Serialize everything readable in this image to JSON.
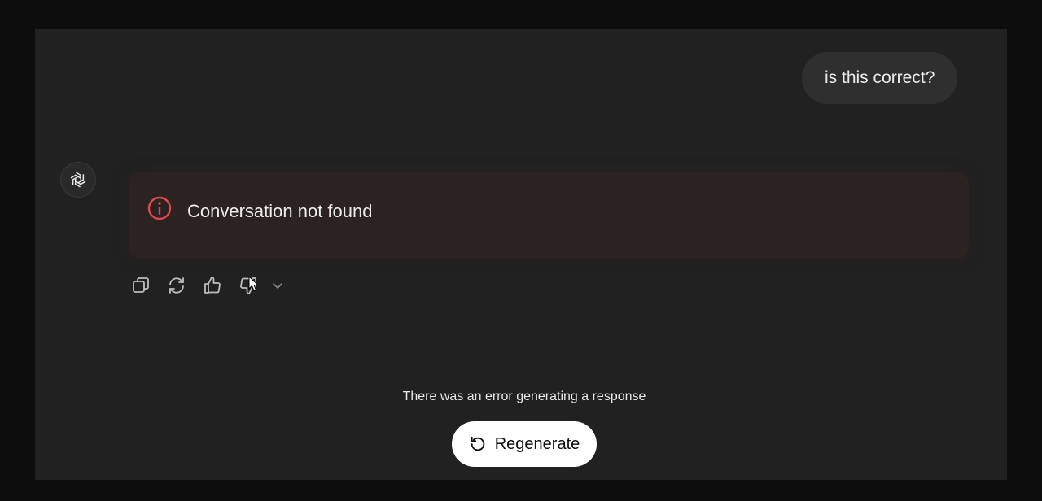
{
  "conversation": {
    "user_message": "is this correct?",
    "assistant_avatar_icon": "openai-logo-icon",
    "error_box": {
      "icon": "alert-circle-icon",
      "text": "Conversation not found",
      "icon_color": "#e5484d"
    }
  },
  "message_actions": [
    {
      "name": "copy",
      "icon": "copy-icon"
    },
    {
      "name": "regenerate",
      "icon": "refresh-icon"
    },
    {
      "name": "thumbs-up",
      "icon": "thumbs-up-icon"
    },
    {
      "name": "thumbs-down",
      "icon": "thumbs-down-icon"
    },
    {
      "name": "more",
      "icon": "chevron-down-icon"
    }
  ],
  "footer": {
    "error_message": "There was an error generating a response",
    "regenerate_label": "Regenerate",
    "regenerate_icon": "rotate-ccw-icon"
  },
  "colors": {
    "background": "#212121",
    "outer": "#0d0d0d",
    "user_bubble": "#2f2f2f",
    "error_bg": "#2b2222",
    "text": "#ececec",
    "button_bg": "#ffffff"
  }
}
